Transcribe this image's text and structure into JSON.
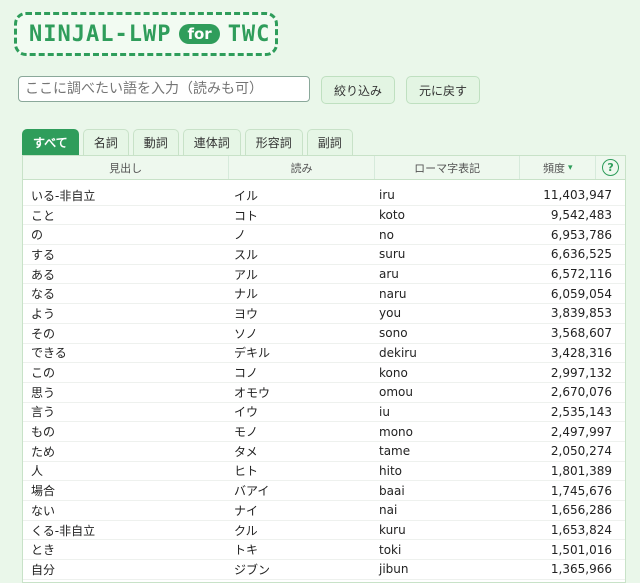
{
  "logo": {
    "main": "NINJAL-LWP",
    "for": "for",
    "twc": "TWC"
  },
  "search": {
    "placeholder": "ここに調べたい語を入力（読みも可）"
  },
  "buttons": {
    "filter": "絞り込み",
    "reset": "元に戻す"
  },
  "tabs": [
    "すべて",
    "名詞",
    "動詞",
    "連体詞",
    "形容詞",
    "副詞"
  ],
  "active_tab": "すべて",
  "columns": {
    "headword": "見出し",
    "reading": "読み",
    "romaji": "ローマ字表記",
    "frequency": "頻度",
    "help": "?"
  },
  "rows": [
    {
      "headword": "いる-非自立",
      "reading": "イル",
      "romaji": "iru",
      "frequency": "11,403,947"
    },
    {
      "headword": "こと",
      "reading": "コト",
      "romaji": "koto",
      "frequency": "9,542,483"
    },
    {
      "headword": "の",
      "reading": "ノ",
      "romaji": "no",
      "frequency": "6,953,786"
    },
    {
      "headword": "する",
      "reading": "スル",
      "romaji": "suru",
      "frequency": "6,636,525"
    },
    {
      "headword": "ある",
      "reading": "アル",
      "romaji": "aru",
      "frequency": "6,572,116"
    },
    {
      "headword": "なる",
      "reading": "ナル",
      "romaji": "naru",
      "frequency": "6,059,054"
    },
    {
      "headword": "よう",
      "reading": "ヨウ",
      "romaji": "you",
      "frequency": "3,839,853"
    },
    {
      "headword": "その",
      "reading": "ソノ",
      "romaji": "sono",
      "frequency": "3,568,607"
    },
    {
      "headword": "できる",
      "reading": "デキル",
      "romaji": "dekiru",
      "frequency": "3,428,316"
    },
    {
      "headword": "この",
      "reading": "コノ",
      "romaji": "kono",
      "frequency": "2,997,132"
    },
    {
      "headword": "思う",
      "reading": "オモウ",
      "romaji": "omou",
      "frequency": "2,670,076"
    },
    {
      "headword": "言う",
      "reading": "イウ",
      "romaji": "iu",
      "frequency": "2,535,143"
    },
    {
      "headword": "もの",
      "reading": "モノ",
      "romaji": "mono",
      "frequency": "2,497,997"
    },
    {
      "headword": "ため",
      "reading": "タメ",
      "romaji": "tame",
      "frequency": "2,050,274"
    },
    {
      "headword": "人",
      "reading": "ヒト",
      "romaji": "hito",
      "frequency": "1,801,389"
    },
    {
      "headword": "場合",
      "reading": "バアイ",
      "romaji": "baai",
      "frequency": "1,745,676"
    },
    {
      "headword": "ない",
      "reading": "ナイ",
      "romaji": "nai",
      "frequency": "1,656,286"
    },
    {
      "headword": "くる-非自立",
      "reading": "クル",
      "romaji": "kuru",
      "frequency": "1,653,824"
    },
    {
      "headword": "とき",
      "reading": "トキ",
      "romaji": "toki",
      "frequency": "1,501,016"
    },
    {
      "headword": "自分",
      "reading": "ジブン",
      "romaji": "jibun",
      "frequency": "1,365,966"
    }
  ],
  "colors": {
    "accent": "#2f9d5b",
    "background": "#eaf7ea"
  },
  "icons": {
    "sort": "sort-desc-icon",
    "help": "help-circle-icon"
  }
}
